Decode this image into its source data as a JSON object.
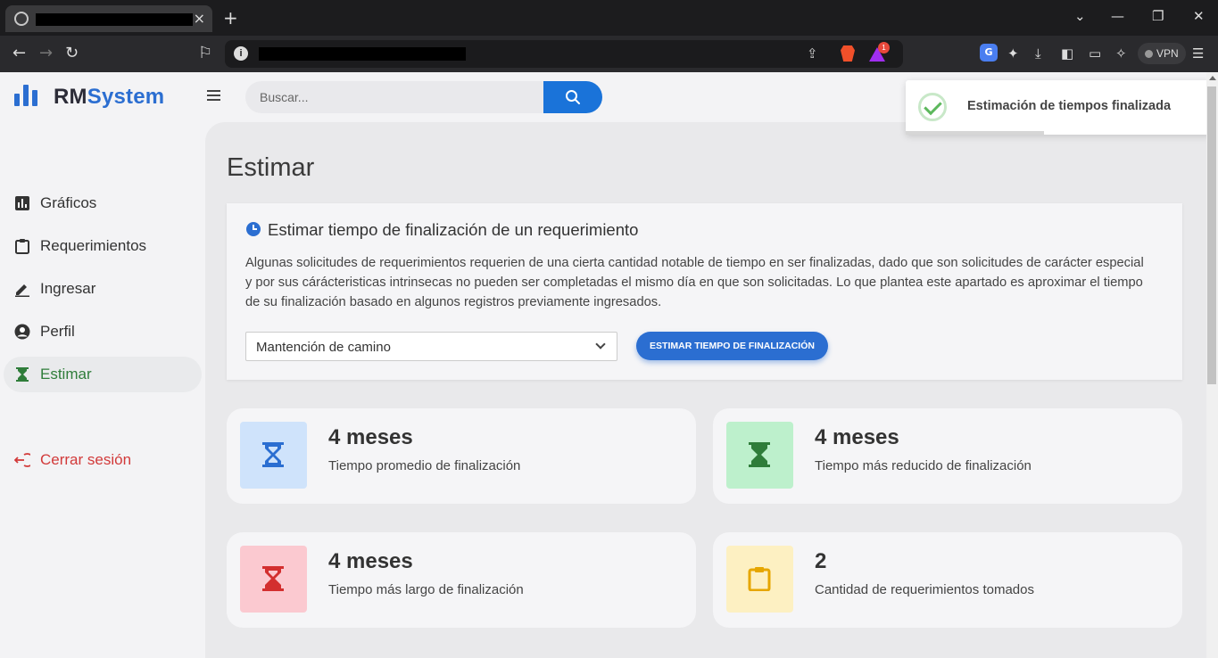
{
  "browser": {
    "tab_close": "×",
    "new_tab": "+",
    "vpn_label": "VPN",
    "extension_badge": "1"
  },
  "header": {
    "brand_rm": "RM",
    "brand_system": "System",
    "search_placeholder": "Buscar..."
  },
  "sidebar": {
    "items": [
      {
        "label": "Gráficos",
        "icon": "bar-chart-icon"
      },
      {
        "label": "Requerimientos",
        "icon": "clipboard-icon"
      },
      {
        "label": "Ingresar",
        "icon": "pencil-icon"
      },
      {
        "label": "Perfil",
        "icon": "user-circle-icon"
      },
      {
        "label": "Estimar",
        "icon": "hourglass-icon",
        "active": true
      }
    ],
    "logout_label": "Cerrar sesión"
  },
  "main": {
    "page_title": "Estimar",
    "card": {
      "title": "Estimar tiempo de finalización de un requerimiento",
      "description": "Algunas solicitudes de requerimientos requerien de una cierta cantidad notable de tiempo en ser finalizadas, dado que son solicitudes de carácter especial y por sus cárácteristicas intrinsecas no pueden ser completadas el mismo día en que son solicitadas. Lo que plantea este apartado es aproximar el tiempo de su finalización basado en algunos registros previamente ingresados.",
      "select_value": "Mantención de camino",
      "button_label": "ESTIMAR TIEMPO DE FINALIZACIÓN"
    },
    "stats": [
      {
        "value": "4 meses",
        "label": "Tiempo promedio de finalización",
        "color": "#2b6ed1",
        "bg": "#cfe3fb"
      },
      {
        "value": "4 meses",
        "label": "Tiempo más reducido de finalización",
        "color": "#2f7d3a",
        "bg": "#bdf0cc"
      },
      {
        "value": "4 meses",
        "label": "Tiempo más largo de finalización",
        "color": "#d32f2f",
        "bg": "#fbc9d0"
      },
      {
        "value": "2",
        "label": "Cantidad de requerimientos tomados",
        "color": "#e6a600",
        "bg": "#fdf0c2"
      }
    ]
  },
  "toast": {
    "message": "Estimación de tiempos finalizada"
  }
}
